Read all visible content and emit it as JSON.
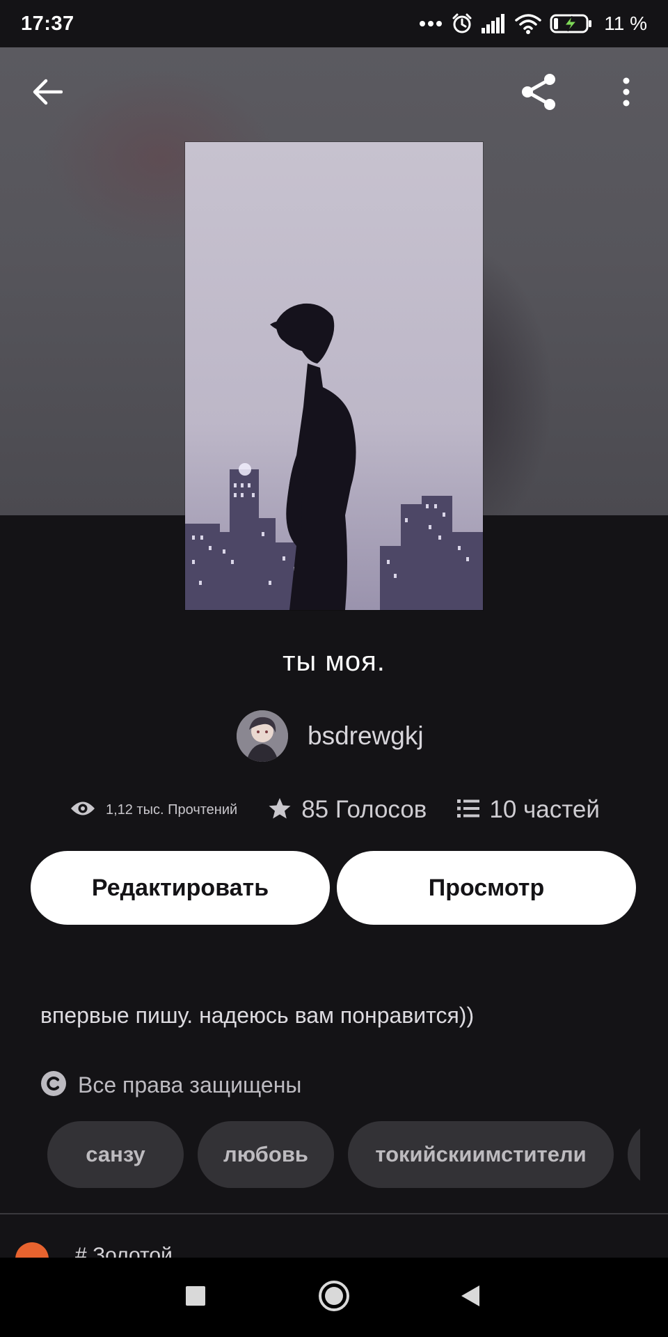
{
  "status_bar": {
    "time": "17:37",
    "icons": [
      "more-dots-icon",
      "alarm-icon",
      "signal-icon",
      "wifi-icon",
      "battery-charging-icon"
    ],
    "battery_percent": "11 %"
  },
  "toolbar": {
    "back_icon": "arrow-left-icon",
    "share_icon": "share-icon",
    "more_icon": "more-vertical-icon"
  },
  "story": {
    "title": "ты моя.",
    "author": "bsdrewgkj",
    "stats": {
      "reads": "1,12 тыс. Прочтений",
      "votes": "85 Голосов",
      "parts": "10 частей"
    },
    "description": "впервые пишу. надеюсь вам понравится))",
    "rights": "Все права защищены"
  },
  "actions": {
    "edit_label": "Редактировать",
    "view_label": "Просмотр"
  },
  "tags": [
    "санзу",
    "любовь",
    "токийскиимстители"
  ],
  "next_section": {
    "text": "# Золотой"
  },
  "nav_bar": {
    "icons": [
      "recent-apps-icon",
      "home-icon",
      "back-icon"
    ]
  },
  "colors": {
    "background": "#141316",
    "button_background": "#ffffff",
    "tag_background": "#333236",
    "accent_orange": "#e7632f"
  }
}
